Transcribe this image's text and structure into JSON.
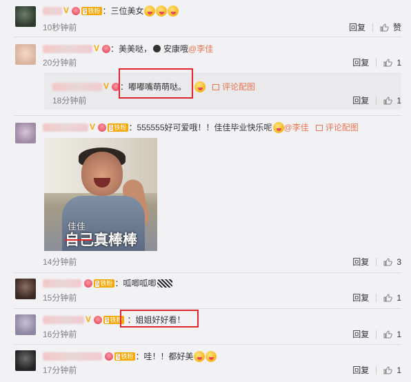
{
  "comments": [
    {
      "text": "：三位美女",
      "time": "10秒钟前",
      "reply": "回复",
      "like_label": "赞"
    },
    {
      "text_a": "：美美哒，",
      "text_b": "安康哦",
      "mention": "@李佳",
      "time": "20分钟前",
      "reply": "回复",
      "like_count": "1",
      "sub_reply": {
        "text": "：嘟嘟嘴萌萌哒。",
        "image_link": "评论配图",
        "time": "18分钟前",
        "reply": "回复",
        "like_count": "1"
      }
    },
    {
      "text": "：555555好可爱哦！！佳佳毕业快乐呢",
      "mention": "@李佳",
      "image_link": "评论配图",
      "image_caption_small": "佳佳",
      "image_caption_large": "自己真棒棒",
      "time": "14分钟前",
      "reply": "回复",
      "like_count": "3"
    },
    {
      "text": "：呱唧呱唧",
      "time": "15分钟前",
      "reply": "回复",
      "like_count": "1"
    },
    {
      "text": "：姐姐好好看！",
      "time": "16分钟前",
      "reply": "回复",
      "like_count": "1"
    },
    {
      "text": "：哇！！都好美",
      "time": "17分钟前",
      "reply": "回复",
      "like_count": "1"
    }
  ],
  "badges": {
    "fan_label": "铁粉",
    "fan_level": "5",
    "verified_mark": "V"
  },
  "colors": {
    "accent": "#eb7350",
    "highlight_box": "#e0242c",
    "fan_badge": "#f6a700",
    "background": "#f2f2f5"
  },
  "icons": [
    "verified-icon",
    "vip-crown-icon",
    "fan-badge-icon",
    "emoji-icon",
    "thumbs-up-icon",
    "image-icon",
    "avatar"
  ]
}
